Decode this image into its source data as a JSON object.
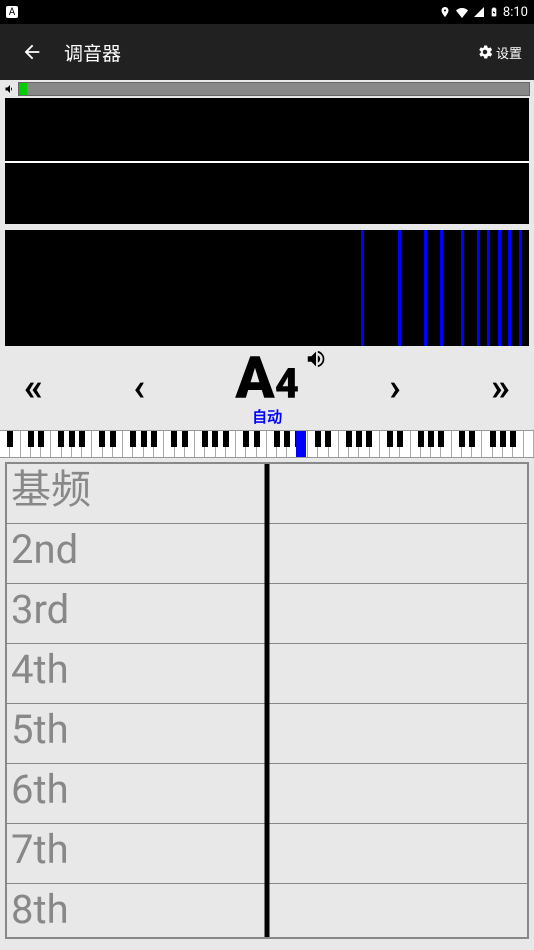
{
  "status": {
    "time": "8:10",
    "badge": "A"
  },
  "appbar": {
    "title": "调音器",
    "settings_label": "设置"
  },
  "note": {
    "letter": "A",
    "octave": "4",
    "mode_label": "自动"
  },
  "spectrum_bars_x_pct": [
    68,
    75,
    80,
    83,
    87,
    90,
    92,
    94,
    96,
    98
  ],
  "piano": {
    "white_count": 52,
    "highlight_pct": 55.5
  },
  "harmonics": {
    "rows": [
      "基频",
      "2nd",
      "3rd",
      "4th",
      "5th",
      "6th",
      "7th",
      "8th"
    ]
  }
}
